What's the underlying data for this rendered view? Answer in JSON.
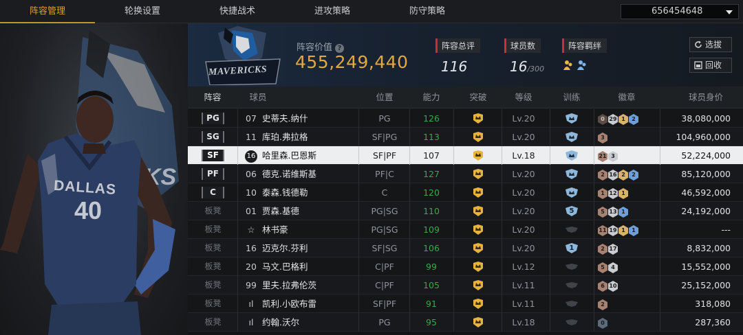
{
  "nav": {
    "tabs": [
      "阵容管理",
      "轮换设置",
      "快捷战术",
      "进攻策略",
      "防守策略"
    ],
    "active_tab": 0,
    "account": "656454648"
  },
  "team": {
    "logo_text": "MAVERICKS",
    "value_label": "阵容价值",
    "value": "455,249,440",
    "rating_label": "阵容总评",
    "rating": "116",
    "player_count_label": "球员数",
    "player_count": "16",
    "player_count_max": "/300",
    "bond_label": "阵容羁绊",
    "select_button": "选拔",
    "recycle_button": "回收"
  },
  "player_art": {
    "jersey_team": "DALLAS",
    "jersey_number": "40"
  },
  "table": {
    "headers": {
      "lineup": "阵容",
      "name": "球员名",
      "position": "位置",
      "ability": "能力",
      "breakthrough": "突破",
      "level": "等级",
      "training": "训练",
      "badges": "徽章",
      "value": "球员身价"
    },
    "rows": [
      {
        "slot": "PG",
        "starter": true,
        "num": "07",
        "name": "史蒂夫.纳什",
        "pos": "PG",
        "ability": "126",
        "level": "Lv.20",
        "train": "crown",
        "badges": [
          {
            "t": "brown",
            "v": "0"
          },
          {
            "t": "silver",
            "v": "29"
          },
          {
            "t": "gold",
            "v": "1"
          },
          {
            "t": "blue",
            "v": "2"
          }
        ],
        "price": "38,080,000",
        "selected": false
      },
      {
        "slot": "SG",
        "starter": true,
        "num": "11",
        "name": "库珀.弗拉格",
        "pos": "SF|PG",
        "ability": "113",
        "level": "Lv.20",
        "train": "crown",
        "badges": [
          {
            "t": "bronze",
            "v": "3"
          }
        ],
        "price": "104,960,000",
        "selected": false
      },
      {
        "slot": "SF",
        "starter": true,
        "num": "16",
        "name": "哈里森.巴恩斯",
        "pos": "SF|PF",
        "ability": "107",
        "level": "Lv.18",
        "train": "crown",
        "badges": [
          {
            "t": "bronze",
            "v": "21"
          },
          {
            "t": "silver",
            "v": "3"
          }
        ],
        "price": "52,224,000",
        "selected": true
      },
      {
        "slot": "PF",
        "starter": true,
        "num": "06",
        "name": "德克.诺维斯基",
        "pos": "PF|C",
        "ability": "127",
        "level": "Lv.20",
        "train": "crown",
        "badges": [
          {
            "t": "bronze",
            "v": "2"
          },
          {
            "t": "silver",
            "v": "16"
          },
          {
            "t": "gold",
            "v": "2"
          },
          {
            "t": "blue",
            "v": "2"
          }
        ],
        "price": "85,120,000",
        "selected": false
      },
      {
        "slot": "C",
        "starter": true,
        "num": "10",
        "name": "泰森.钱德勒",
        "pos": "C",
        "ability": "120",
        "level": "Lv.20",
        "train": "crown",
        "badges": [
          {
            "t": "bronze",
            "v": "1"
          },
          {
            "t": "silver",
            "v": "12"
          },
          {
            "t": "gold",
            "v": "1"
          }
        ],
        "price": "46,592,000",
        "selected": false
      },
      {
        "slot": "板凳",
        "starter": false,
        "num": "01",
        "name": "贾森.基德",
        "pos": "PG|SG",
        "ability": "110",
        "level": "Lv.20",
        "train": "5",
        "badges": [
          {
            "t": "bronze",
            "v": "5"
          },
          {
            "t": "silver",
            "v": "13"
          },
          {
            "t": "blue",
            "v": "1"
          }
        ],
        "price": "24,192,000",
        "selected": false
      },
      {
        "slot": "板凳",
        "starter": false,
        "num": "☆",
        "name": "林书豪",
        "pos": "PG|SG",
        "ability": "109",
        "level": "Lv.20",
        "train": "empty",
        "badges": [
          {
            "t": "bronze",
            "v": "11"
          },
          {
            "t": "silver",
            "v": "19"
          },
          {
            "t": "gold",
            "v": "1"
          },
          {
            "t": "blue",
            "v": "1"
          }
        ],
        "price": "---",
        "selected": false
      },
      {
        "slot": "板凳",
        "starter": false,
        "num": "16",
        "name": "迈克尔.芬利",
        "pos": "SF|SG",
        "ability": "106",
        "level": "Lv.20",
        "train": "1",
        "badges": [
          {
            "t": "bronze",
            "v": "2"
          },
          {
            "t": "silver",
            "v": "17"
          }
        ],
        "price": "8,832,000",
        "selected": false
      },
      {
        "slot": "板凳",
        "starter": false,
        "num": "20",
        "name": "马文.巴格利",
        "pos": "C|PF",
        "ability": "99",
        "level": "Lv.12",
        "train": "empty",
        "badges": [
          {
            "t": "bronze",
            "v": "5"
          },
          {
            "t": "silver",
            "v": "4"
          }
        ],
        "price": "15,552,000",
        "selected": false
      },
      {
        "slot": "板凳",
        "starter": false,
        "num": "99",
        "name": "里夫.拉弗伦茨",
        "pos": "C|PF",
        "ability": "105",
        "level": "Lv.11",
        "train": "empty",
        "badges": [
          {
            "t": "bronze",
            "v": "6"
          },
          {
            "t": "silver",
            "v": "10"
          }
        ],
        "price": "25,152,000",
        "selected": false
      },
      {
        "slot": "板凳",
        "starter": false,
        "num": "ıl",
        "name": "凯利.小欧布雷",
        "pos": "SF|PF",
        "ability": "91",
        "level": "Lv.11",
        "train": "empty",
        "badges": [
          {
            "t": "bronze",
            "v": "2"
          }
        ],
        "price": "318,080",
        "selected": false
      },
      {
        "slot": "板凳",
        "starter": false,
        "num": "ıl",
        "name": "约翰.沃尔",
        "pos": "PG",
        "ability": "95",
        "level": "Lv.18",
        "train": "empty",
        "badges": [
          {
            "t": "grey",
            "v": "0"
          }
        ],
        "price": "287,360",
        "selected": false
      }
    ]
  }
}
